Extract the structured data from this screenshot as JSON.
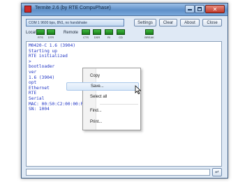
{
  "window": {
    "title": "Termite 2.6 (by RTE CompuPhase)"
  },
  "toolbar": {
    "port_settings": "COM 1 9600 bps, 8N1, no handshake",
    "settings_label": "Settings",
    "clear_label": "Clear",
    "about_label": "About",
    "close_label": "Close"
  },
  "lines": {
    "local_label": "Local",
    "remote_label": "Remote",
    "local_leds": [
      "RTS",
      "DTR"
    ],
    "remote_leds": [
      "CTS",
      "DSR",
      "RI",
      "CD"
    ],
    "extra_led": "BREAK"
  },
  "terminal": {
    "lines": [
      "M0420-C 1.6 (3904)",
      "Starting up",
      "RTE initialized",
      ">",
      "bootloader",
      "ver",
      "1.6 (3904)",
      "opt",
      "Ethernet",
      "RTE",
      "Serial",
      "MAC: 00:50:C2:00:00:F3",
      "SN: 1004"
    ]
  },
  "context_menu": {
    "items": [
      {
        "label": "Copy"
      },
      {
        "label": "Save..."
      },
      {
        "label": "Select all"
      },
      {
        "label": "Find..."
      },
      {
        "label": "Print..."
      }
    ]
  },
  "send_button": {
    "label": "↵"
  },
  "colors": {
    "terminal_text": "#1f34c4",
    "led_on": "#2a9a2a",
    "title_bar": "#6f9fd6"
  }
}
